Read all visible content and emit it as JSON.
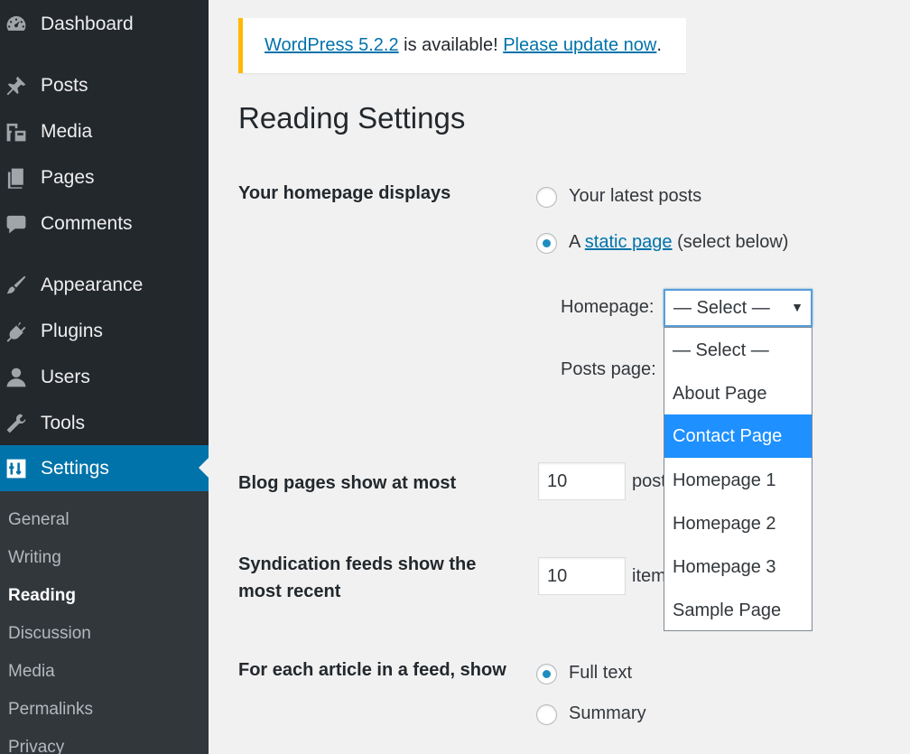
{
  "sidebar": {
    "items": [
      {
        "label": "Dashboard",
        "icon": "dashboard-icon"
      },
      {
        "label": "Posts",
        "icon": "pushpin-icon"
      },
      {
        "label": "Media",
        "icon": "media-icon"
      },
      {
        "label": "Pages",
        "icon": "pages-icon"
      },
      {
        "label": "Comments",
        "icon": "comments-icon"
      },
      {
        "label": "Appearance",
        "icon": "paintbrush-icon"
      },
      {
        "label": "Plugins",
        "icon": "plugin-icon"
      },
      {
        "label": "Users",
        "icon": "user-icon"
      },
      {
        "label": "Tools",
        "icon": "wrench-icon"
      },
      {
        "label": "Settings",
        "icon": "settings-icon"
      }
    ],
    "submenu": [
      "General",
      "Writing",
      "Reading",
      "Discussion",
      "Media",
      "Permalinks",
      "Privacy"
    ]
  },
  "notice": {
    "version_link": "WordPress 5.2.2",
    "middle_text": " is available! ",
    "update_link": "Please update now",
    "end_text": "."
  },
  "page_title": "Reading Settings",
  "homepage_displays": {
    "label": "Your homepage displays",
    "option_latest": "Your latest posts",
    "option_static_prefix": "A ",
    "option_static_link": "static page",
    "option_static_suffix": " (select below)",
    "homepage_label": "Homepage:",
    "posts_page_label": "Posts page:",
    "selected_value": "— Select —",
    "dropdown_options": [
      "— Select —",
      "About Page",
      "Contact Page",
      "Homepage 1",
      "Homepage 2",
      "Homepage 3",
      "Sample Page"
    ],
    "highlighted_option": "Contact Page"
  },
  "blog_pages": {
    "label": "Blog pages show at most",
    "value": "10",
    "after": "posts"
  },
  "syndication": {
    "label_line1": "Syndication feeds show the",
    "label_line2": "most recent",
    "value": "10",
    "after": "items"
  },
  "feed_article": {
    "label": "For each article in a feed, show",
    "option_full": "Full text",
    "option_summary": "Summary"
  },
  "colors": {
    "sidebar_bg": "#23282d",
    "submenu_bg": "#32373c",
    "accent": "#0073aa",
    "notice_border": "#ffb900",
    "highlight": "#1e90ff"
  }
}
